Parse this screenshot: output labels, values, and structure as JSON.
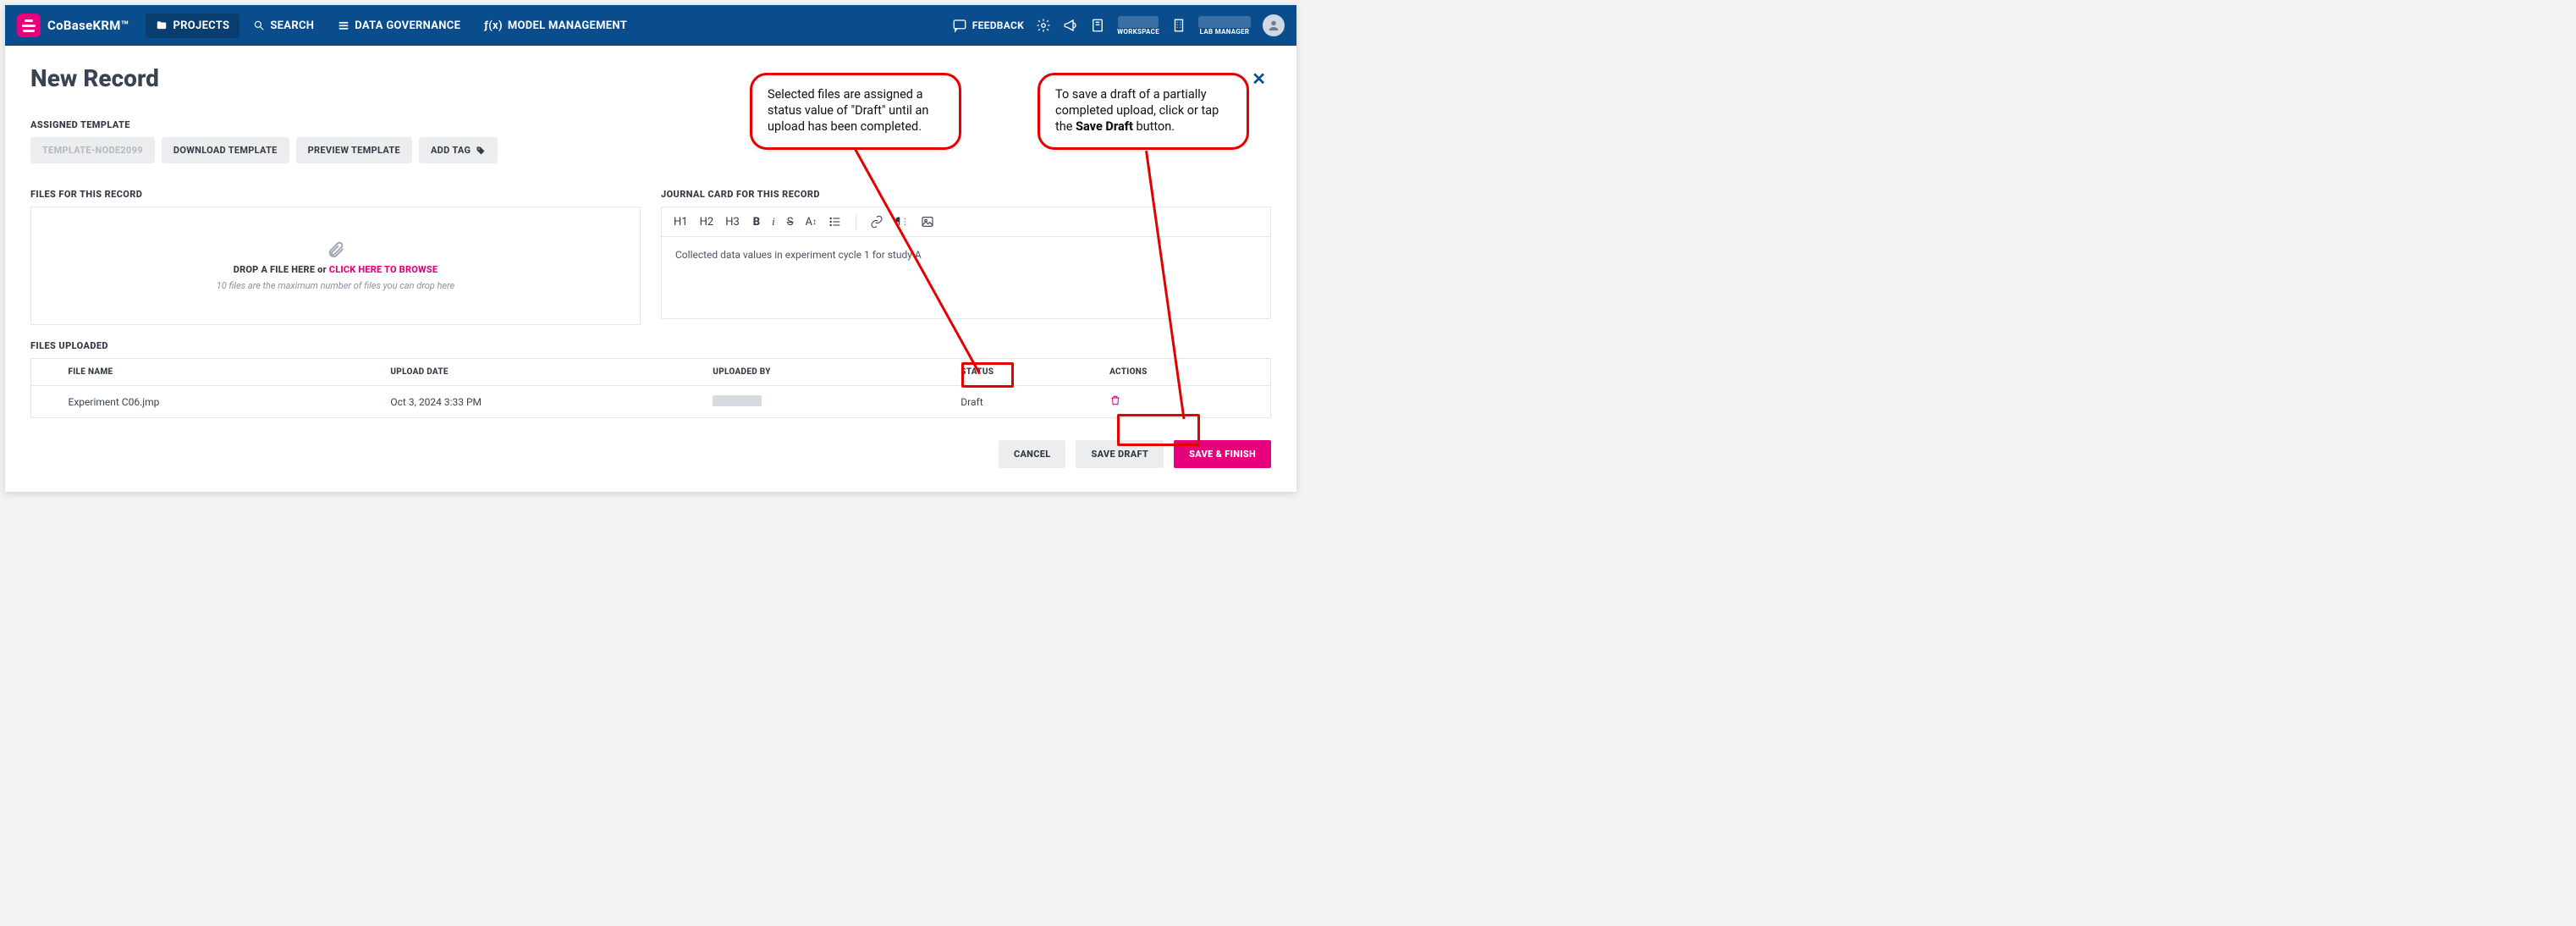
{
  "brand_name": "CoBaseKRM™",
  "nav": {
    "projects": "PROJECTS",
    "search": "SEARCH",
    "governance": "DATA GOVERNANCE",
    "model_mgmt": "MODEL MANAGEMENT",
    "feedback": "FEEDBACK",
    "workspace": "WORKSPACE",
    "role": "LAB MANAGER"
  },
  "page": {
    "title": "New Record"
  },
  "template": {
    "label": "ASSIGNED TEMPLATE",
    "node": "TEMPLATE-NODE2099",
    "download": "DOWNLOAD TEMPLATE",
    "preview": "PREVIEW TEMPLATE",
    "addtag": "ADD TAG"
  },
  "files_section": {
    "label": "FILES FOR THIS RECORD",
    "drop_text_a": "DROP A FILE HERE or ",
    "drop_text_b": "CLICK HERE TO BROWSE",
    "drop_sub": "10 files are the maximum number of files you can drop here"
  },
  "journal": {
    "label": "JOURNAL CARD FOR THIS RECORD",
    "tb": {
      "h1": "H1",
      "h2": "H2",
      "h3": "H3",
      "b": "B",
      "i": "i",
      "s": "S",
      "a": "A"
    },
    "content": "Collected data values in experiment cycle 1 for study A"
  },
  "uploaded": {
    "label": "FILES UPLOADED",
    "cols": {
      "file": "FILE NAME",
      "date": "UPLOAD DATE",
      "by": "UPLOADED BY",
      "status": "STATUS",
      "actions": "ACTIONS"
    },
    "rows": [
      {
        "file": "Experiment C06.jmp",
        "date": "Oct 3, 2024 3:33 PM",
        "status": "Draft"
      }
    ]
  },
  "footer": {
    "cancel": "CANCEL",
    "draft": "SAVE DRAFT",
    "finish": "SAVE & FINISH"
  },
  "callouts": {
    "c1_a": "Selected files are assigned a status value of \"Draft\" until an upload has been completed.",
    "c2_a": "To save a draft of a partially completed upload, click or tap the ",
    "c2_b": "Save Draft",
    "c2_c": " button."
  }
}
